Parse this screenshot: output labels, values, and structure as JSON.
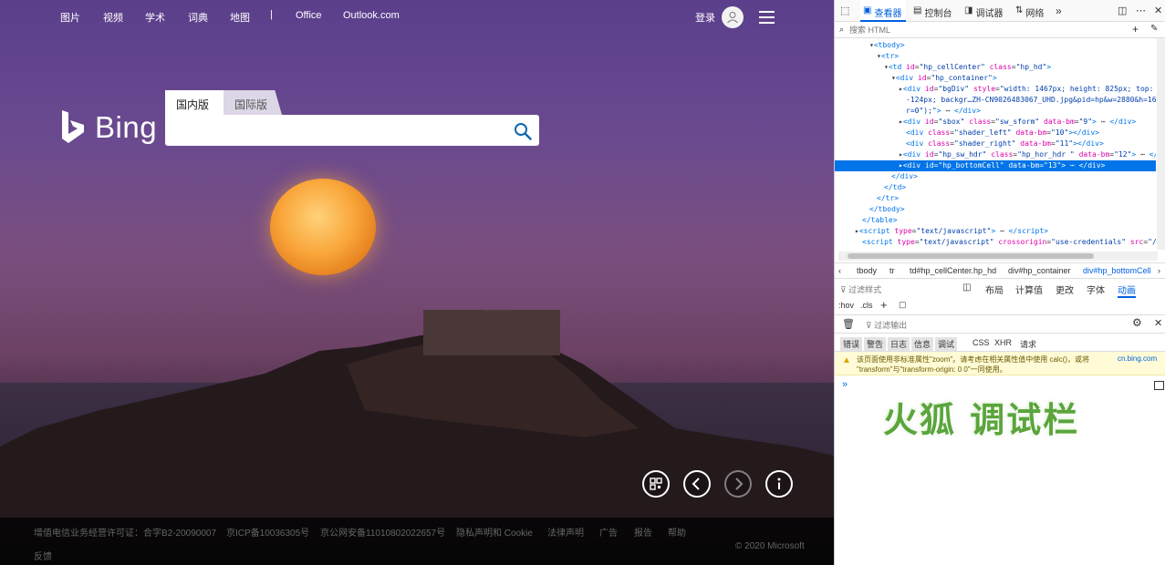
{
  "bing": {
    "nav": [
      "图片",
      "视频",
      "学术",
      "词典",
      "地图"
    ],
    "nav_sep": "|",
    "office": "Office",
    "outlook": "Outlook.com",
    "login": "登录",
    "logo_text": "Bing",
    "tab_domestic": "国内版",
    "tab_international": "国际版",
    "search_value": "",
    "footer_links": [
      "增值电信业务经营许可证：合字B2-20090007",
      "京ICP备10036305号",
      "京公网安备11010802022657号",
      "隐私声明和 Cookie",
      "法律声明",
      "广告",
      "报告",
      "帮助"
    ],
    "feedback": "反馈",
    "copyright": "© 2020 Microsoft"
  },
  "devtools": {
    "tabs": [
      "查看器",
      "控制台",
      "调试器",
      "网络"
    ],
    "search_placeholder": "搜索 HTML",
    "html_lines": [
      {
        "indent": 0,
        "html": "▾<span class='tg'>&lt;tbody&gt;</span>"
      },
      {
        "indent": 1,
        "html": "▾<span class='tg'>&lt;tr&gt;</span>"
      },
      {
        "indent": 2,
        "html": "▾<span class='tg'>&lt;td</span> <span class='an'>id</span>=<span class='av'>\"hp_cellCenter\"</span> <span class='an'>class</span>=<span class='av'>\"hp_hd\"</span><span class='tg'>&gt;</span>"
      },
      {
        "indent": 3,
        "html": "▾<span class='tg'>&lt;div</span> <span class='an'>id</span>=<span class='av'>\"hp_container\"</span><span class='tg'>&gt;</span>"
      },
      {
        "indent": 4,
        "html": "▸<span class='tg'>&lt;div</span> <span class='an'>id</span>=<span class='av'>\"bgDiv\"</span> <span class='an'>style</span>=<span class='av'>\"width: 1467px; height: 825px; top: 0px;</span>"
      },
      {
        "indent": 5,
        "html": "<span class='av'>-124px; backgr…ZH-CN9026483067_UHD.jpg&amp;pid=hp&amp;w=2880&amp;h=1620&amp;rs</span>"
      },
      {
        "indent": 5,
        "html": "<span class='av'>r=0\");\"</span><span class='tg'>&gt;</span> ⋯ <span class='tg'>&lt;/div&gt;</span>"
      },
      {
        "indent": 4,
        "html": "▸<span class='tg'>&lt;div</span> <span class='an'>id</span>=<span class='av'>\"sbox\"</span> <span class='an'>class</span>=<span class='av'>\"sw_sform\"</span> <span class='an'>data-bm</span>=<span class='av'>\"9\"</span><span class='tg'>&gt;</span> ⋯ <span class='tg'>&lt;/div&gt;</span>"
      },
      {
        "indent": 5,
        "html": "<span class='tg'>&lt;div</span> <span class='an'>class</span>=<span class='av'>\"shader_left\"</span> <span class='an'>data-bm</span>=<span class='av'>\"10\"</span><span class='tg'>&gt;&lt;/div&gt;</span>"
      },
      {
        "indent": 5,
        "html": "<span class='tg'>&lt;div</span> <span class='an'>class</span>=<span class='av'>\"shader_right\"</span> <span class='an'>data-bm</span>=<span class='av'>\"11\"</span><span class='tg'>&gt;&lt;/div&gt;</span>"
      },
      {
        "indent": 4,
        "html": "▸<span class='tg'>&lt;div</span> <span class='an'>id</span>=<span class='av'>\"hp_sw_hdr\"</span> <span class='an'>class</span>=<span class='av'>\"hp_hor_hdr \"</span> <span class='an'>data-bm</span>=<span class='av'>\"12\"</span><span class='tg'>&gt;</span> ⋯ <span class='tg'>&lt;/div&gt;</span>"
      },
      {
        "indent": 4,
        "sel": true,
        "html": "▸<span class='tg'>&lt;div</span> <span class='an'>id</span>=<span class='av'>\"hp_bottomCell\"</span> <span class='an'>data-bm</span>=<span class='av'>\"13\"</span><span class='tg'>&gt;</span> ⋯ <span class='tg'>&lt;/div&gt;</span>"
      },
      {
        "indent": 3,
        "html": "<span class='tg'>&lt;/div&gt;</span>"
      },
      {
        "indent": 2,
        "html": "<span class='tg'>&lt;/td&gt;</span>"
      },
      {
        "indent": 1,
        "html": "<span class='tg'>&lt;/tr&gt;</span>"
      },
      {
        "indent": 0,
        "html": "<span class='tg'>&lt;/tbody&gt;</span>"
      },
      {
        "indent": -1,
        "html": "<span class='tg'>&lt;/table&gt;</span>"
      },
      {
        "indent": -2,
        "html": "▸<span class='tg'>&lt;script</span> <span class='an'>type</span>=<span class='av'>\"text/javascript\"</span><span class='tg'>&gt;</span> ⋯ <span class='tg'>&lt;/script&gt;</span>"
      },
      {
        "indent": -1,
        "html": "<span class='tg'>&lt;script</span> <span class='an'>type</span>=<span class='av'>\"text/javascript\"</span> <span class='an'>crossorigin</span>=<span class='av'>\"use-credentials\"</span> <span class='an'>src</span>=<span class='av'>\"/rs/5</span>"
      },
      {
        "indent": -1,
        "html": "<span class='av'>/TQ3vXNkmQnQ5AxXG7uRek8TW4Pw.js\"</span><span class='tg'>&gt;&lt;/script&gt;</span>"
      }
    ],
    "breadcrumbs": [
      "tbody",
      "tr",
      "td#hp_cellCenter.hp_hd",
      "div#hp_container",
      "div#hp_bottomCell"
    ],
    "filter_styles": "过滤样式",
    "hov": ":hov",
    "cls": ".cls",
    "side_tabs": [
      "布局",
      "计算值",
      "更改",
      "字体",
      "动画"
    ],
    "filter_output": "过滤输出",
    "console_filters": [
      "错误",
      "警告",
      "日志",
      "信息",
      "调试",
      "CSS",
      "XHR",
      "请求"
    ],
    "warning_line1": "该页面使用非标准属性\"zoom\"。请考虑在相关属性值中使用 calc()，或将",
    "warning_line2": "\"transform\"与\"transform-origin: 0 0\"一同使用。",
    "warning_source": "cn.bing.com",
    "prompt": "»"
  },
  "caption": "火狐 调试栏"
}
